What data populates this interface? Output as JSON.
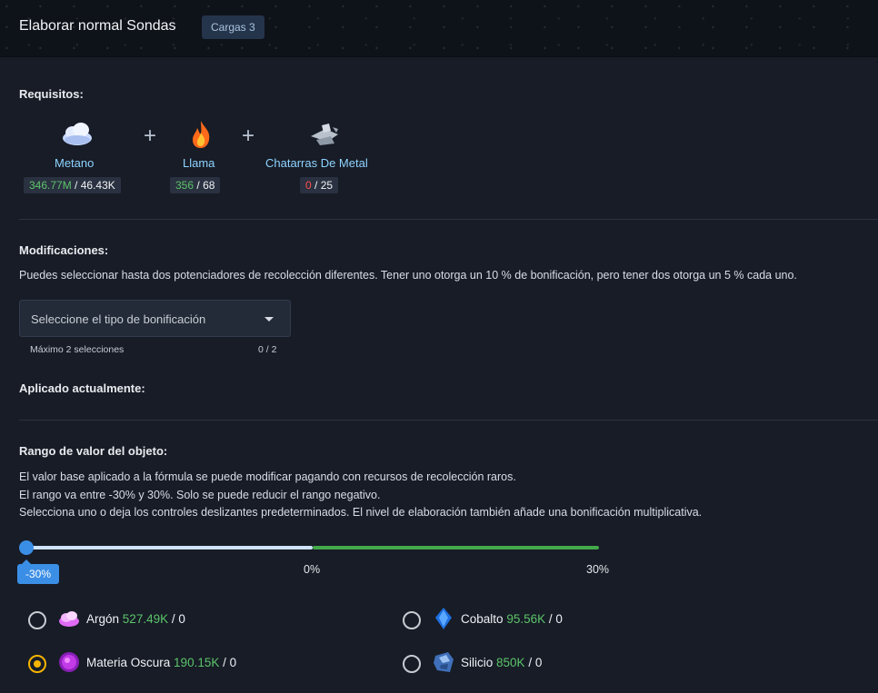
{
  "header": {
    "title": "Elaborar normal Sondas",
    "badge": "Cargas 3"
  },
  "requirements": {
    "title": "Requisitos:",
    "items": [
      {
        "name": "Metano",
        "have": "346.77M",
        "need": "46.43K",
        "have_status": "ok",
        "icon": "methane-cloud-icon"
      },
      {
        "name": "Llama",
        "have": "356",
        "need": "68",
        "have_status": "ok",
        "icon": "flame-icon"
      },
      {
        "name": "Chatarras De Metal",
        "have": "0",
        "need": "25",
        "have_status": "insufficient",
        "icon": "scrap-metal-icon"
      }
    ],
    "separator": "+"
  },
  "modifications": {
    "title": "Modificaciones:",
    "description": "Puedes seleccionar hasta dos potenciadores de recolección diferentes. Tener uno otorga un 10 % de bonificación, pero tener dos otorga un 5 % cada uno.",
    "select_placeholder": "Seleccione el tipo de bonificación",
    "max_note": "Máximo 2 selecciones",
    "count": "0 / 2",
    "applied_title": "Aplicado actualmente:"
  },
  "range": {
    "title": "Rango de valor del objeto:",
    "lines": [
      "El valor base aplicado a la fórmula se puede modificar pagando con recursos de recolección raros.",
      "El rango va entre -30% y 30%. Solo se puede reducir el rango negativo.",
      "Selecciona uno o deja los controles deslizantes predeterminados. El nivel de elaboración también añade una bonificación multiplicativa."
    ],
    "slider_value": -30,
    "slider_tooltip": "-30%",
    "tick_mid": "0%",
    "tick_max": "30%"
  },
  "resources": [
    {
      "name": "Argón",
      "amount": "527.49K",
      "cost": "0",
      "selected": false,
      "icon": "argon-cloud-icon"
    },
    {
      "name": "Cobalto",
      "amount": "95.56K",
      "cost": "0",
      "selected": false,
      "icon": "cobalt-crystal-icon"
    },
    {
      "name": "Materia Oscura",
      "amount": "190.15K",
      "cost": "0",
      "selected": true,
      "icon": "dark-matter-orb-icon"
    },
    {
      "name": "Silicio",
      "amount": "850K",
      "cost": "0",
      "selected": false,
      "icon": "silicon-rock-icon"
    }
  ],
  "colors": {
    "accent": "#3b8ee6",
    "positive": "#5cc46a",
    "negative": "#ff4d4d",
    "radio_selected": "#f5b400",
    "link": "#8fd3ff"
  }
}
